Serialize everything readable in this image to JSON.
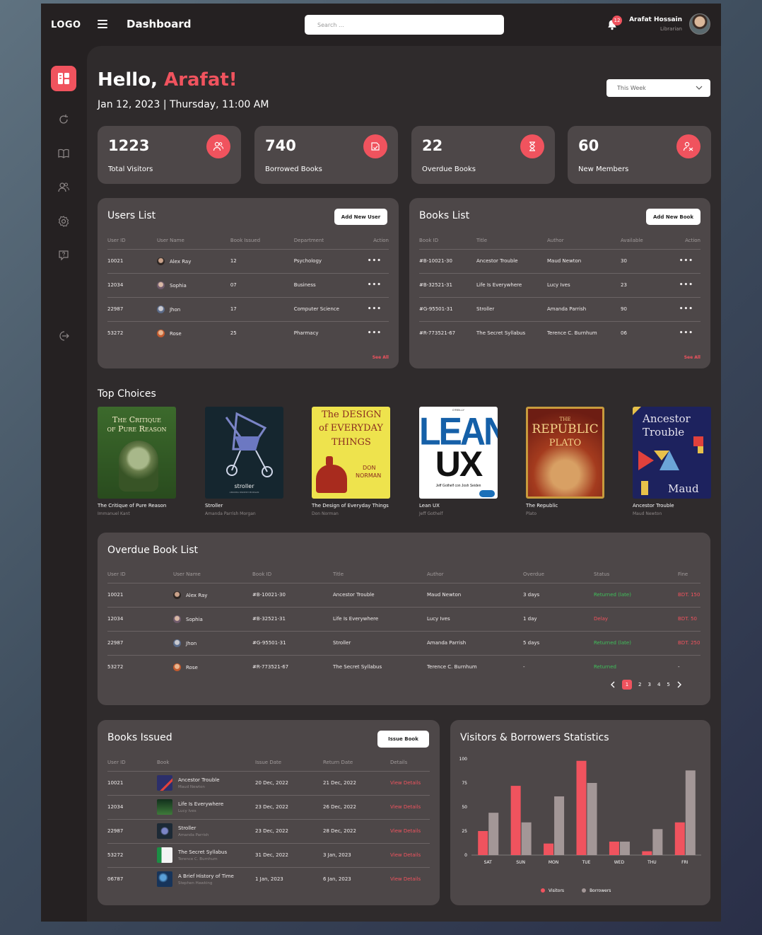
{
  "topbar": {
    "logo": "LOGO",
    "page_name": "Dashboard",
    "search_placeholder": "Search ...",
    "notification_count": "12",
    "user_name": "Arafat Hossain",
    "user_role": "Librarian"
  },
  "header": {
    "greeting": "Hello,",
    "greeting_name": "Arafat!",
    "date_line": "Jan 12, 2023 | Thursday, 11:00 AM",
    "period_select": "This Week"
  },
  "stats": [
    {
      "value": "1223",
      "label": "Total Visitors",
      "icon": "users-icon"
    },
    {
      "value": "740",
      "label": "Borrowed Books",
      "icon": "book-open-icon"
    },
    {
      "value": "22",
      "label": "Overdue Books",
      "icon": "hourglass-icon"
    },
    {
      "value": "60",
      "label": "New Members",
      "icon": "user-plus-icon"
    }
  ],
  "users_list": {
    "title": "Users List",
    "add_button": "Add New User",
    "see_all": "See All",
    "columns": [
      "User ID",
      "User Name",
      "Book Issued",
      "Department",
      "Action"
    ],
    "rows": [
      {
        "id": "10021",
        "name": "Alex Ray",
        "issued": "12",
        "dept": "Psychology",
        "action": "•••"
      },
      {
        "id": "12034",
        "name": "Sophia",
        "issued": "07",
        "dept": "Business",
        "action": "•••"
      },
      {
        "id": "22987",
        "name": "Jhon",
        "issued": "17",
        "dept": "Computer Science",
        "action": "•••"
      },
      {
        "id": "53272",
        "name": "Rose",
        "issued": "25",
        "dept": "Pharmacy",
        "action": "•••"
      }
    ]
  },
  "books_list": {
    "title": "Books List",
    "add_button": "Add New Book",
    "see_all": "See All",
    "columns": [
      "Book ID",
      "Title",
      "Author",
      "Available",
      "Action"
    ],
    "rows": [
      {
        "id": "#B-10021-30",
        "title": "Ancestor Trouble",
        "author": "Maud Newton",
        "available": "30",
        "action": "•••"
      },
      {
        "id": "#B-32521-31",
        "title": "Life Is Everywhere",
        "author": "Lucy Ives",
        "available": "23",
        "action": "•••"
      },
      {
        "id": "#G-95501-31",
        "title": "Stroller",
        "author": "Amanda Parrish",
        "available": "90",
        "action": "•••"
      },
      {
        "id": "#R-773521-67",
        "title": "The Secret Syllabus",
        "author": "Terence C. Burnhum",
        "available": "06",
        "action": "•••"
      }
    ]
  },
  "top_choices": {
    "title": "Top Choices",
    "books": [
      {
        "title": "The Critique of Pure Reason",
        "author": "Immanuel Kant",
        "cover_l1": "The Critique",
        "cover_l2": "of Pure Reason"
      },
      {
        "title": "Stroller",
        "author": "Amanda Parrish Morgan",
        "cover_l1": "stroller",
        "cover_l2": "AMANDA PARRISH MORGAN"
      },
      {
        "title": "The Design of Everyday Things",
        "author": "Don Norman",
        "cover_l1": "The DESIGN",
        "cover_l2": "of EVERYDAY",
        "cover_l3": "THINGS",
        "cover_l4": "DON",
        "cover_l5": "NORMAN"
      },
      {
        "title": "Lean UX",
        "author": "Jeff Gothelf",
        "cover_l1": "LEAN",
        "cover_l2": "UX",
        "cover_l3": "Jeff Gothelf con Josh Seiden",
        "cover_l4": "O'REILLY"
      },
      {
        "title": "The Republic",
        "author": "Plato",
        "cover_l1": "THE",
        "cover_l2": "REPUBLIC",
        "cover_l3": "PLATO"
      },
      {
        "title": "Ancestor Trouble",
        "author": "Maud Newton",
        "cover_l1": "Ancestor",
        "cover_l2": "Trouble",
        "cover_l3": "Maud"
      }
    ]
  },
  "overdue": {
    "title": "Overdue Book List",
    "columns": [
      "User ID",
      "User Name",
      "Book ID",
      "Title",
      "Author",
      "Overdue",
      "Status",
      "Fine"
    ],
    "rows": [
      {
        "id": "10021",
        "name": "Alex Ray",
        "book_id": "#B-10021-30",
        "title": "Ancestor Trouble",
        "author": "Maud Newton",
        "overdue": "3 days",
        "status": "Returned (late)",
        "fine": "BDT. 150"
      },
      {
        "id": "12034",
        "name": "Sophia",
        "book_id": "#B-32521-31",
        "title": "Life Is Everywhere",
        "author": "Lucy Ives",
        "overdue": "1 day",
        "status": "Delay",
        "fine": "BDT. 50"
      },
      {
        "id": "22987",
        "name": "Jhon",
        "book_id": "#G-95501-31",
        "title": "Stroller",
        "author": "Amanda Parrish",
        "overdue": "5 days",
        "status": "Returned (late)",
        "fine": "BDT. 250"
      },
      {
        "id": "53272",
        "name": "Rose",
        "book_id": "#R-773521-67",
        "title": "The Secret Syllabus",
        "author": "Terence C. Burnhum",
        "overdue": "-",
        "status": "Returned",
        "fine": "-"
      }
    ],
    "pages": [
      "1",
      "2",
      "3",
      "4",
      "5"
    ],
    "current_page": "1"
  },
  "books_issued": {
    "title": "Books Issued",
    "issue_button": "Issue Book",
    "columns": [
      "User ID",
      "Book",
      "Issue Date",
      "Return Date",
      "Details"
    ],
    "rows": [
      {
        "id": "10021",
        "book": "Ancestor Trouble",
        "author": "Maud Newton",
        "issue": "20 Dec, 2022",
        "return": "21 Dec, 2022",
        "details": "View Details",
        "thumb": "#2c2f6a"
      },
      {
        "id": "12034",
        "book": "Life Is Everywhere",
        "author": "Lucy Ives",
        "issue": "23 Dec, 2022",
        "return": "26 Dec, 2022",
        "details": "View Details",
        "thumb": "#12301c"
      },
      {
        "id": "22987",
        "book": "Stroller",
        "author": "Amanda Parrish",
        "issue": "23 Dec, 2022",
        "return": "28 Dec, 2022",
        "details": "View Details",
        "thumb": "#1d2a36"
      },
      {
        "id": "53272",
        "book": "The Secret Syllabus",
        "author": "Terence C. Burnhum",
        "issue": "31 Dec, 2022",
        "return": "3 Jan, 2023",
        "details": "View Details",
        "thumb": "#1b8e44"
      },
      {
        "id": "06787",
        "book": "A Brief History of Time",
        "author": "Stephen Hawking",
        "issue": "1 Jan, 2023",
        "return": "6 Jan, 2023",
        "details": "View Details",
        "thumb": "#17345a"
      }
    ]
  },
  "stats_chart": {
    "title": "Visitors & Borrowers Statistics"
  },
  "chart_data": {
    "type": "bar",
    "categories": [
      "SAT",
      "SUN",
      "MON",
      "TUE",
      "WED",
      "THU",
      "FRI"
    ],
    "series": [
      {
        "name": "Visitors",
        "values": [
          25,
          72,
          12,
          98,
          14,
          4,
          34
        ],
        "color": "#f0535e"
      },
      {
        "name": "Borrowers",
        "values": [
          44,
          34,
          61,
          75,
          14,
          27,
          88
        ],
        "color": "#a39797"
      }
    ],
    "yticks": [
      "0",
      "25",
      "50",
      "75",
      "100"
    ],
    "ylim": [
      0,
      100
    ],
    "legend": "bottom"
  }
}
